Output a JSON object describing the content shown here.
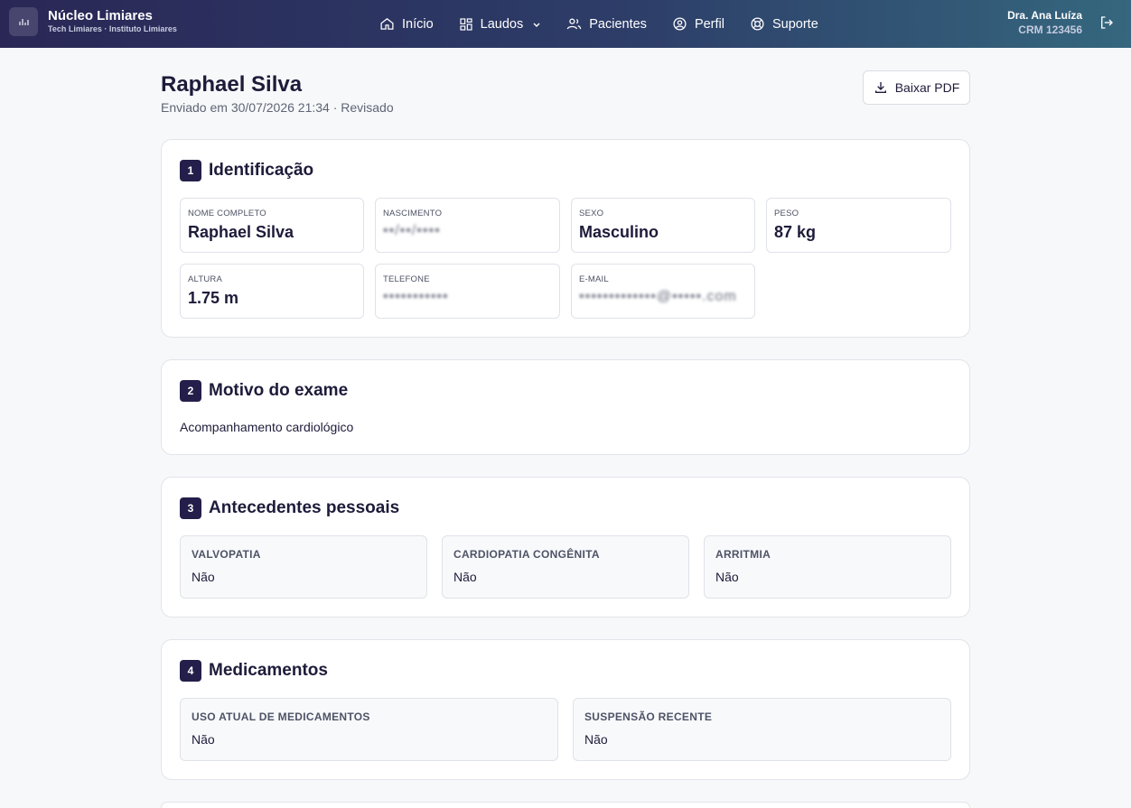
{
  "app": {
    "name": "Núcleo Limiares",
    "subtitle": "Tech Limiares · Instituto Limiares"
  },
  "nav": {
    "items": [
      {
        "label": "Início",
        "icon": "home-icon"
      },
      {
        "label": "Laudos",
        "icon": "grid-icon"
      },
      {
        "label": "Pacientes",
        "icon": "users-icon"
      },
      {
        "label": "Perfil",
        "icon": "user-circle-icon"
      },
      {
        "label": "Suporte",
        "icon": "lifebuoy-icon"
      }
    ]
  },
  "user": {
    "name": "Dra. Ana Luíza",
    "crm": "CRM 123456"
  },
  "header": {
    "title": "Raphael Silva",
    "meta": "Enviado em 30/07/2026 21:34 · Revisado",
    "pdf_button": "Baixar PDF"
  },
  "sections": {
    "identificacao": {
      "number": "1",
      "title": "Identificação",
      "fields": [
        {
          "label": "NOME COMPLETO",
          "value": "Raphael Silva"
        },
        {
          "label": "NASCIMENTO",
          "value": "••/••/••••"
        },
        {
          "label": "SEXO",
          "value": "Masculino"
        },
        {
          "label": "PESO",
          "value": "87 kg"
        },
        {
          "label": "ALTURA",
          "value": "1.75 m"
        },
        {
          "label": "TELEFONE",
          "value": "•••••••••••"
        },
        {
          "label": "E-MAIL",
          "value": "•••••••••••••@•••••.com"
        }
      ]
    },
    "motivo": {
      "number": "2",
      "title": "Motivo do exame",
      "text": "Acompanhamento cardiológico"
    },
    "antecedentes": {
      "number": "3",
      "title": "Antecedentes pessoais",
      "items": [
        {
          "label": "VALVOPATIA",
          "value": "Não"
        },
        {
          "label": "CARDIOPATIA CONGÊNITA",
          "value": "Não"
        },
        {
          "label": "ARRITMIA",
          "value": "Não"
        }
      ]
    },
    "medicamentos": {
      "number": "4",
      "title": "Medicamentos",
      "items": [
        {
          "label": "USO ATUAL DE MEDICAMENTOS",
          "value": "Não"
        },
        {
          "label": "SUSPENSÃO RECENTE",
          "value": "Não"
        }
      ]
    }
  }
}
